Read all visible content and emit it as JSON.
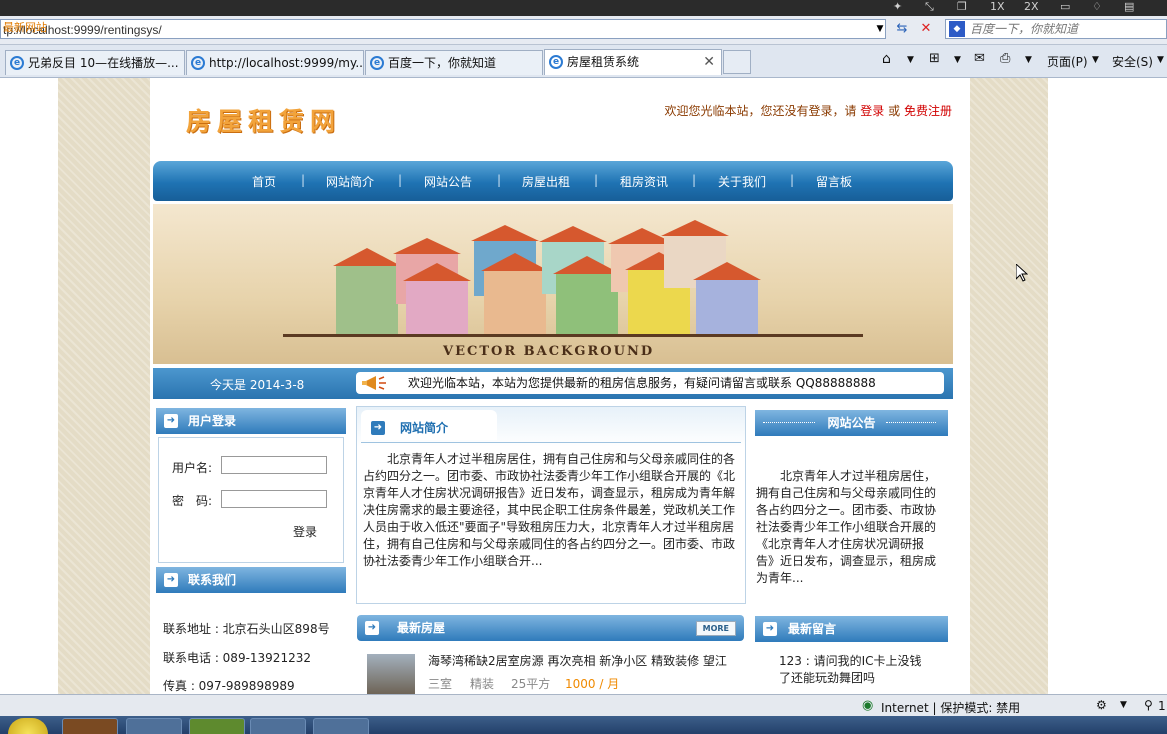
{
  "browser": {
    "address_overlay": "最新网站",
    "url": "tp://localhost:9999/rentingsys/",
    "search_placeholder": "百度一下，你就知道",
    "top_icons": [
      "1X",
      "2X"
    ],
    "tabs": [
      {
        "label": "兄弟反目 10—在线播放—..."
      },
      {
        "label": "http://localhost:9999/my..."
      },
      {
        "label": "百度一下，你就知道"
      },
      {
        "label": "房屋租赁系统",
        "active": true
      }
    ],
    "commands": {
      "page": "页面(P)",
      "safety": "安全(S)"
    },
    "status": {
      "zone": "Internet | 保护模式: 禁用",
      "zoom": "1"
    }
  },
  "site": {
    "logo": "房屋租赁网",
    "welcome_prefix": "欢迎您光临本站，您还没有登录，请",
    "login_link": "登录",
    "or": "或",
    "register_link": "免费注册",
    "nav": [
      "首页",
      "网站简介",
      "网站公告",
      "房屋出租",
      "租房资讯",
      "关于我们",
      "留言板"
    ],
    "banner_text": "VECTOR BACKGROUND",
    "date": "今天是 2014-3-8",
    "notice": "欢迎光临本站，本站为您提供最新的租房信息服务，有疑问请留言或联系 QQ88888888",
    "login_box": {
      "title": "用户登录",
      "username_label": "用户名:",
      "password_label": "密　码:",
      "submit": "登录"
    },
    "contact": {
      "title": "联系我们",
      "address": "联系地址 : 北京石头山区898号",
      "phone": "联系电话 : 089-13921232",
      "fax": "传真 : 097-989898989"
    },
    "intro": {
      "title": "网站简介",
      "text": "　　北京青年人才过半租房居住，拥有自己住房和与父母亲戚同住的各占约四分之一。团市委、市政协社法委青少年工作小组联合开展的《北京青年人才住房状况调研报告》近日发布，调查显示，租房成为青年解决住房需求的最主要途径，其中民企职工住房条件最差，党政机关工作人员由于收入低还\"要面子\"导致租房压力大，北京青年人才过半租房居住，拥有自己住房和与父母亲戚同住的各占约四分之一。团市委、市政协社法委青少年工作小组联合开..."
    },
    "announcement": {
      "title": "网站公告",
      "text": "　　北京青年人才过半租房居住，拥有自己住房和与父母亲戚同住的各占约四分之一。团市委、市政协社法委青少年工作小组联合开展的《北京青年人才住房状况调研报告》近日发布，调查显示，租房成为青年..."
    },
    "latest_houses": {
      "title": "最新房屋",
      "more": "MORE",
      "item_title": "海琴湾稀缺2居室房源 再次亮相 新净小区 精致装修 望江",
      "rooms": "三室",
      "decor": "精装",
      "area": "25平方",
      "price": "1000 / 月"
    },
    "latest_messages": {
      "title": "最新留言",
      "item": "123 : 请问我的IC卡上没钱了还能玩劲舞团吗"
    }
  },
  "colors": {
    "nav_blue": "#1f73b3",
    "logo_orange": "#f2a33b",
    "price_orange": "#f08a00",
    "link_red": "#d10000"
  }
}
